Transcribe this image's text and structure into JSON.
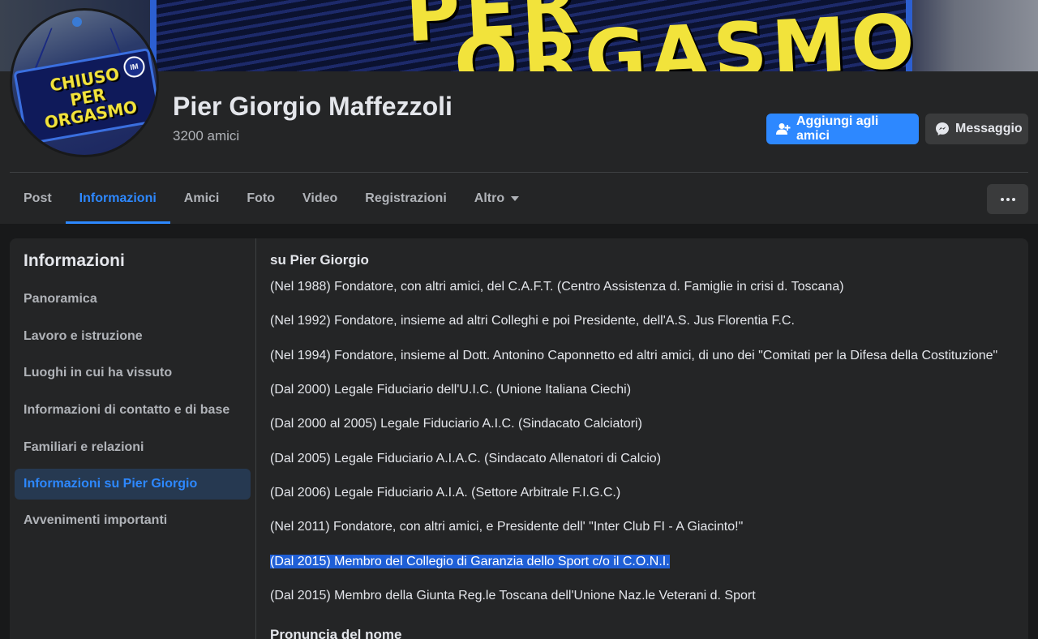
{
  "cover": {
    "text_top": "PER",
    "text_bottom": "ORGASMO"
  },
  "avatar": {
    "sign_lines": [
      "CHIUSO",
      "PER",
      "ORGASMO"
    ]
  },
  "profile": {
    "name": "Pier Giorgio Maffezzoli",
    "friends": "3200 amici"
  },
  "actions": {
    "add_friend": "Aggiungi agli amici",
    "message": "Messaggio"
  },
  "tabs": [
    {
      "label": "Post"
    },
    {
      "label": "Informazioni",
      "active": true
    },
    {
      "label": "Amici"
    },
    {
      "label": "Foto"
    },
    {
      "label": "Video"
    },
    {
      "label": "Registrazioni"
    },
    {
      "label": "Altro"
    }
  ],
  "sidebar": {
    "title": "Informazioni",
    "items": [
      {
        "label": "Panoramica"
      },
      {
        "label": "Lavoro e istruzione"
      },
      {
        "label": "Luoghi in cui ha vissuto"
      },
      {
        "label": "Informazioni di contatto e di base"
      },
      {
        "label": "Familiari e relazioni"
      },
      {
        "label": "Informazioni su Pier Giorgio",
        "active": true
      },
      {
        "label": "Avvenimenti importanti"
      }
    ]
  },
  "about": {
    "title": "su Pier Giorgio",
    "lines": [
      "(Nel 1988) Fondatore, con altri amici, del C.A.F.T. (Centro Assistenza d. Famiglie in crisi d. Toscana)",
      "(Nel 1992) Fondatore, insieme ad altri Colleghi e poi Presidente, dell'A.S. Jus Florentia F.C.",
      "(Nel 1994) Fondatore, insieme al Dott. Antonino Caponnetto ed altri amici, di uno dei \"Comitati per la Difesa della Costituzione\"",
      "(Dal 2000) Legale Fiduciario dell'U.I.C. (Unione Italiana Ciechi)",
      "(Dal 2000 al 2005) Legale Fiduciario A.I.C. (Sindacato Calciatori)",
      "(Dal 2005) Legale Fiduciario A.I.A.C. (Sindacato Allenatori di Calcio)",
      "(Dal 2006) Legale Fiduciario A.I.A. (Settore Arbitrale F.I.G.C.)",
      "(Nel 2011) Fondatore, con altri amici, e Presidente dell' \"Inter Club FI - A Giacinto!\"",
      "(Dal 2015) Membro del Collegio di Garanzia dello Sport c/o il C.O.N.I.",
      "(Dal 2015) Membro della Giunta Reg.le Toscana dell'Unione Naz.le Veterani d. Sport"
    ],
    "selected_line_index": 8,
    "next_section_title": "Pronuncia del nome"
  },
  "colors": {
    "accent": "#2d88ff",
    "surface": "#242526",
    "background": "#18191a",
    "selection": "#1f5fd6"
  }
}
